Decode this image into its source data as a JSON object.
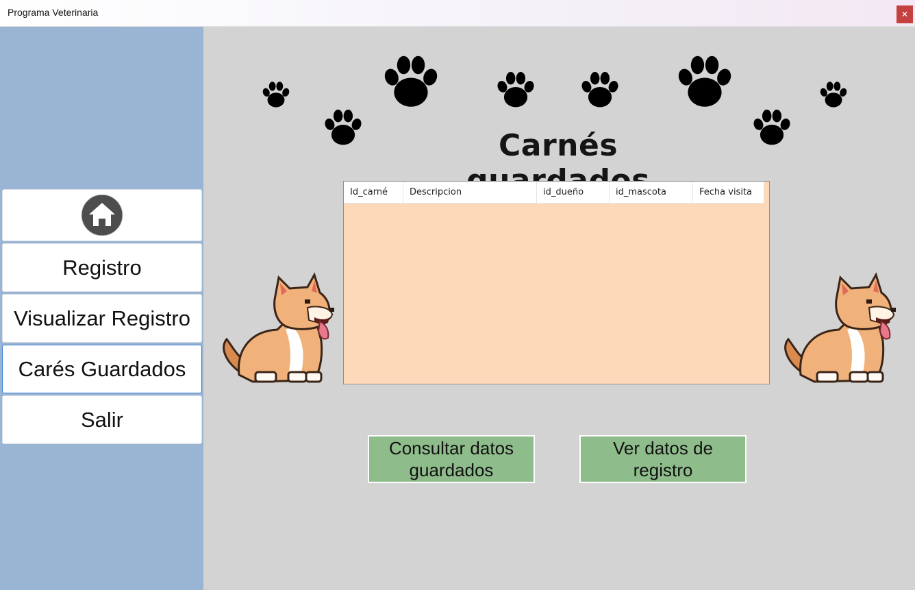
{
  "window": {
    "title": "Programa Veterinaria",
    "close_glyph": "✕"
  },
  "sidebar": {
    "home_icon": "home-icon",
    "items": [
      {
        "label": "Registro"
      },
      {
        "label": "Visualizar Registro"
      },
      {
        "label": "Carés Guardados"
      },
      {
        "label": "Salir"
      }
    ]
  },
  "main": {
    "heading": "Carnés guardados",
    "table": {
      "columns": [
        "Id_carné",
        "Descripcion",
        "id_dueño",
        "id_mascota",
        "Fecha visita"
      ],
      "rows": []
    },
    "buttons": {
      "consult_label": "Consultar datos guardados",
      "view_label": "Ver datos de registro"
    }
  },
  "colors": {
    "sidebar": "#9ab4d3",
    "background": "#d3d3d3",
    "table_body": "#fdd9b9",
    "action_button": "#8fbc8b",
    "close_button": "#c4413f",
    "active_border": "#3b7fd4"
  },
  "decorations": [
    "paw-print-icon",
    "shiba-dog-illustration"
  ]
}
